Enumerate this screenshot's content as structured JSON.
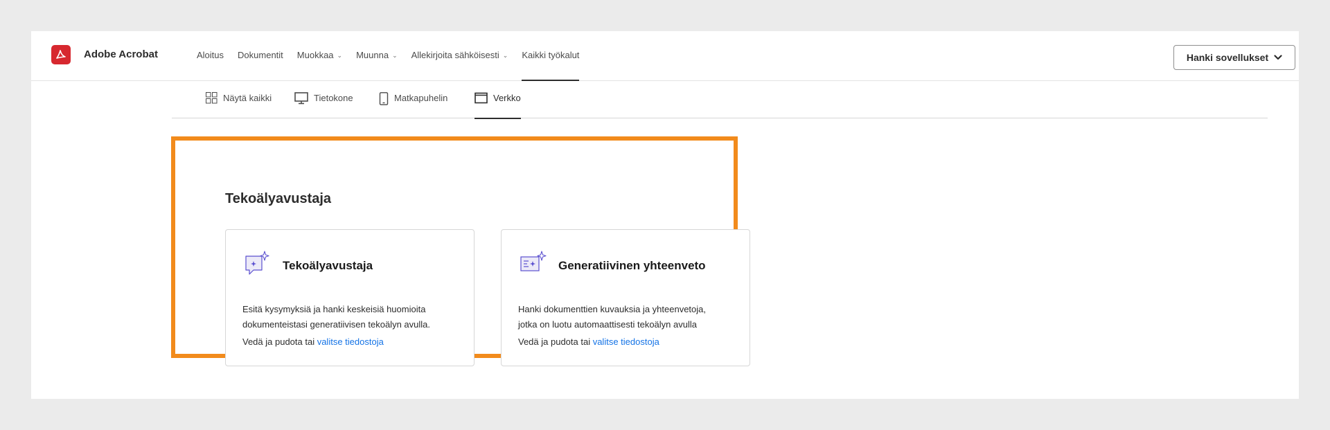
{
  "app": {
    "brand": "Adobe Acrobat",
    "accent_color": "#d7282f",
    "highlight_color": "#f28b1c",
    "link_color": "#1473e6"
  },
  "nav": {
    "items": [
      {
        "label": "Aloitus",
        "has_menu": false,
        "active": false
      },
      {
        "label": "Dokumentit",
        "has_menu": false,
        "active": false
      },
      {
        "label": "Muokkaa",
        "has_menu": true,
        "active": false
      },
      {
        "label": "Muunna",
        "has_menu": true,
        "active": false
      },
      {
        "label": "Allekirjoita sähköisesti",
        "has_menu": true,
        "active": false
      },
      {
        "label": "Kaikki työkalut",
        "has_menu": false,
        "active": true
      }
    ],
    "get_apps_label": "Hanki sovellukset"
  },
  "filters": {
    "tabs": [
      {
        "label": "Näytä kaikki",
        "icon": "grid-icon",
        "active": false
      },
      {
        "label": "Tietokone",
        "icon": "desktop-icon",
        "active": false
      },
      {
        "label": "Matkapuhelin",
        "icon": "mobile-icon",
        "active": false
      },
      {
        "label": "Verkko",
        "icon": "browser-window-icon",
        "active": true
      }
    ]
  },
  "section": {
    "title": "Tekoälyavustaja",
    "cards": [
      {
        "title": "Tekoälyavustaja",
        "icon": "ai-chat-sparkle-icon",
        "desc_line1": "Esitä kysymyksiä ja hanki keskeisiä huomioita",
        "desc_line2": "dokumenteistasi generatiivisen tekoälyn avulla.",
        "action_prefix": "Vedä ja pudota tai ",
        "action_link": "valitse tiedostoja"
      },
      {
        "title": "Generatiivinen yhteenveto",
        "icon": "ai-summary-sparkle-icon",
        "desc_line1": "Hanki dokumenttien kuvauksia ja yhteenvetoja,",
        "desc_line2": "jotka on luotu automaattisesti tekoälyn avulla",
        "action_prefix": "Vedä ja pudota tai ",
        "action_link": "valitse tiedostoja"
      }
    ]
  }
}
